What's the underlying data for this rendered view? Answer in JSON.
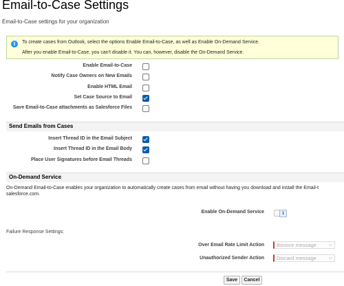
{
  "header": {
    "title": "Email-to-Case Settings",
    "subtitle": "Email-to-Case settings for your organization"
  },
  "info": {
    "line1": "To create cases from Outlook, select the options Enable Email-to-Case, as well as Enable On-Demand Service.",
    "line2": "After you enable Email-to-Case, you can't disable it. You can, however, disable the On-Demand Service."
  },
  "settings": [
    {
      "label": "Enable Email-to-Case",
      "checked": false
    },
    {
      "label": "Notify Case Owners on New Emails",
      "checked": false
    },
    {
      "label": "Enable HTML Email",
      "checked": false
    },
    {
      "label": "Set Case Source to Email",
      "checked": true
    },
    {
      "label": "Save Email-to-Case attachments as Salesforce Files",
      "checked": false
    }
  ],
  "send_emails": {
    "title": "Send Emails from Cases",
    "items": [
      {
        "label": "Insert Thread ID in the Email Subject",
        "checked": true
      },
      {
        "label": "Insert Thread ID in the Email Body",
        "checked": true
      },
      {
        "label": "Place User Signatures before Email Threads",
        "checked": false
      }
    ]
  },
  "on_demand": {
    "title": "On-Demand Service",
    "description_line1": "On-Demand Email-to-Case enables your organization to automatically create cases from email without having you download and install the Email-t",
    "description_line2": "salesforce.com.",
    "enable_label": "Enable On-Demand Service",
    "enabled": false,
    "info_icon": "i"
  },
  "failure": {
    "title": "Failure Response Settings:",
    "rate_limit_label": "Over Email Rate Limit Action",
    "rate_limit_value": "Bounce message",
    "unauthorized_label": "Unauthorized Sender Action",
    "unauthorized_value": "Discard message"
  },
  "actions": {
    "save_label": "Save",
    "cancel_label": "Cancel"
  },
  "colors": {
    "accent": "#0b5cab",
    "info_bg": "#ffffd9",
    "required": "#c23934"
  }
}
